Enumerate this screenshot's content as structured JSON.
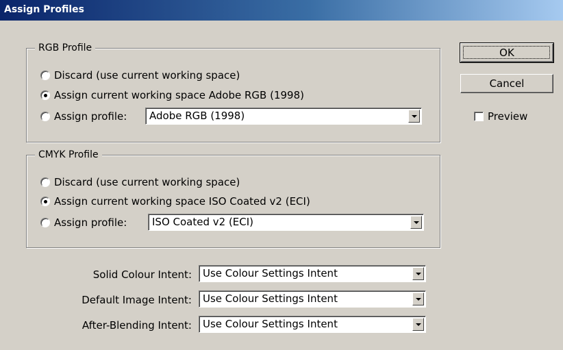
{
  "window": {
    "title": "Assign Profiles"
  },
  "rgb_group": {
    "title": "RGB Profile",
    "options": [
      {
        "label": "Discard (use current working space)",
        "checked": false
      },
      {
        "label": "Assign current working space Adobe RGB (1998)",
        "checked": true
      },
      {
        "label": "Assign profile:",
        "checked": false
      }
    ],
    "profile_select": "Adobe RGB (1998)"
  },
  "cmyk_group": {
    "title": "CMYK Profile",
    "options": [
      {
        "label": "Discard (use current working space)",
        "checked": false
      },
      {
        "label": "Assign current working space ISO Coated v2 (ECI)",
        "checked": true
      },
      {
        "label": "Assign profile:",
        "checked": false
      }
    ],
    "profile_select": "ISO Coated v2 (ECI)"
  },
  "intents": [
    {
      "label": "Solid Colour Intent:",
      "value": "Use Colour Settings Intent"
    },
    {
      "label": "Default Image Intent:",
      "value": "Use Colour Settings Intent"
    },
    {
      "label": "After-Blending Intent:",
      "value": "Use Colour Settings Intent"
    }
  ],
  "buttons": {
    "ok": "OK",
    "cancel": "Cancel"
  },
  "preview": {
    "label": "Preview",
    "checked": false
  }
}
